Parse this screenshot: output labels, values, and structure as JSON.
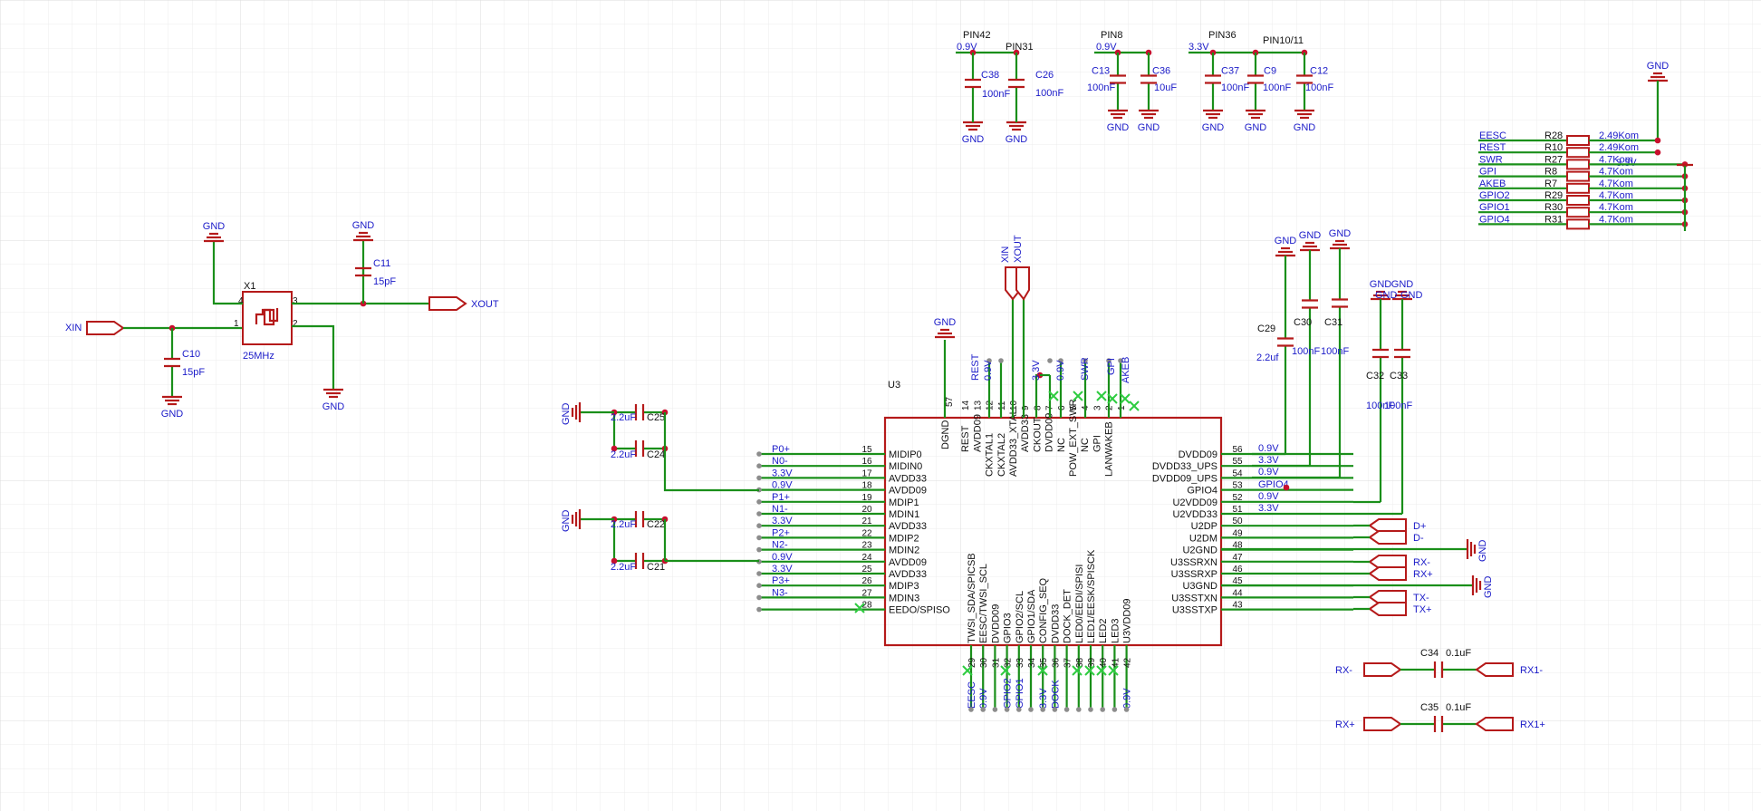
{
  "crystal": {
    "ref": "X1",
    "value": "25MHz",
    "in_net": "XIN",
    "out_net": "XOUT",
    "c_in": {
      "ref": "C10",
      "value": "15pF"
    },
    "c_out": {
      "ref": "C11",
      "value": "15pF"
    }
  },
  "gnd_label": "GND",
  "chip": {
    "ref": "U3"
  },
  "decoupling": {
    "pin42": "PIN42",
    "pin31": "PIN31",
    "pin8": "PIN8",
    "pin36": "PIN36",
    "pin10_11": "PIN10/11",
    "v09": "0.9V",
    "v33": "3.3V",
    "caps": [
      {
        "ref": "C38",
        "value": "100nF"
      },
      {
        "ref": "C26",
        "value": "100nF"
      },
      {
        "ref": "C13",
        "value": "100nF"
      },
      {
        "ref": "C36",
        "value": "10uF"
      },
      {
        "ref": "C37",
        "value": "100nF"
      },
      {
        "ref": "C9",
        "value": "100nF"
      },
      {
        "ref": "C12",
        "value": "100nF"
      }
    ]
  },
  "pullups": {
    "rail": "3.3V",
    "rows": [
      {
        "net": "EESC",
        "ref": "R28",
        "value": "2.49Kom"
      },
      {
        "net": "REST",
        "ref": "R10",
        "value": "2.49Kom"
      },
      {
        "net": "SWR",
        "ref": "R27",
        "value": "4.7Kom"
      },
      {
        "net": "GPI",
        "ref": "R8",
        "value": "4.7Kom"
      },
      {
        "net": "AKEB",
        "ref": "R7",
        "value": "4.7Kom"
      },
      {
        "net": "GPIO2",
        "ref": "R29",
        "value": "4.7Kom"
      },
      {
        "net": "GPIO1",
        "ref": "R30",
        "value": "4.7Kom"
      },
      {
        "net": "GPIO4",
        "ref": "R31",
        "value": "4.7Kom"
      }
    ]
  },
  "left_pins": [
    {
      "num": "15",
      "name": "MIDIP0",
      "net": "P0+"
    },
    {
      "num": "16",
      "name": "MIDIN0",
      "net": "N0-"
    },
    {
      "num": "17",
      "name": "AVDD33",
      "net": "3.3V"
    },
    {
      "num": "18",
      "name": "AVDD09",
      "net": "0.9V"
    },
    {
      "num": "19",
      "name": "MDIP1",
      "net": "P1+"
    },
    {
      "num": "20",
      "name": "MDIN1",
      "net": "N1-"
    },
    {
      "num": "21",
      "name": "AVDD33",
      "net": "3.3V"
    },
    {
      "num": "22",
      "name": "MDIP2",
      "net": "P2+"
    },
    {
      "num": "23",
      "name": "MDIN2",
      "net": "N2-"
    },
    {
      "num": "24",
      "name": "AVDD09",
      "net": "0.9V"
    },
    {
      "num": "25",
      "name": "AVDD33",
      "net": "3.3V"
    },
    {
      "num": "26",
      "name": "MDIP3",
      "net": "P3+"
    },
    {
      "num": "27",
      "name": "MDIN3",
      "net": "N3-"
    },
    {
      "num": "28",
      "name": "EEDO/SPISO",
      "net": ""
    }
  ],
  "right_pins": [
    {
      "num": "56",
      "name": "DVDD09",
      "net": "0.9V"
    },
    {
      "num": "55",
      "name": "DVDD33_UPS",
      "net": "3.3V"
    },
    {
      "num": "54",
      "name": "DVDD09_UPS",
      "net": "0.9V"
    },
    {
      "num": "53",
      "name": "GPIO4",
      "net": "GPIO4"
    },
    {
      "num": "52",
      "name": "U2VDD09",
      "net": "0.9V"
    },
    {
      "num": "51",
      "name": "U2VDD33",
      "net": "3.3V"
    },
    {
      "num": "50",
      "name": "U2DP",
      "net": "D+"
    },
    {
      "num": "49",
      "name": "U2DM",
      "net": "D-"
    },
    {
      "num": "48",
      "name": "U2GND",
      "net": "GND"
    },
    {
      "num": "47",
      "name": "U3SSRXN",
      "net": "RX-"
    },
    {
      "num": "46",
      "name": "U3SSRXP",
      "net": "RX+"
    },
    {
      "num": "45",
      "name": "U3GND",
      "net": "GND"
    },
    {
      "num": "44",
      "name": "U3SSTXN",
      "net": "TX-"
    },
    {
      "num": "43",
      "name": "U3SSTXP",
      "net": "TX+"
    }
  ],
  "top_pins": [
    {
      "num": "57",
      "name": "DGND",
      "net": "GND"
    },
    {
      "num": "14",
      "name": "REST",
      "net": "REST"
    },
    {
      "num": "13",
      "name": "AVDD09",
      "net": "0.9V"
    },
    {
      "num": "12",
      "name": "CKXTAL1",
      "net": "XIN"
    },
    {
      "num": "11",
      "name": "CKXTAL2",
      "net": "XOUT"
    },
    {
      "num": "10",
      "name": "AVDD33_XTAL",
      "net": "3.3V"
    },
    {
      "num": "9",
      "name": "AVDD33",
      "net": ""
    },
    {
      "num": "8",
      "name": "CKOUT",
      "net": "0.9V"
    },
    {
      "num": "7",
      "name": "DVDD09",
      "net": ""
    },
    {
      "num": "6",
      "name": "NC",
      "net": "SWR"
    },
    {
      "num": "5",
      "name": "POW_EXT_SWR",
      "net": ""
    },
    {
      "num": "4",
      "name": "NC",
      "net": ""
    },
    {
      "num": "3",
      "name": "GPI",
      "net": "GPI"
    },
    {
      "num": "2",
      "name": "LANWAKEB",
      "net": "AKEB"
    },
    {
      "num": "1",
      "name": "",
      "net": ""
    }
  ],
  "bottom_pins": [
    {
      "num": "29",
      "name": "TWSI_SDA/SPICSB",
      "net": "EESC"
    },
    {
      "num": "30",
      "name": "EESC/TWSI_SCL",
      "net": "0.9V"
    },
    {
      "num": "31",
      "name": "DVDD09",
      "net": ""
    },
    {
      "num": "32",
      "name": "GPIO3",
      "net": "GPIO2"
    },
    {
      "num": "33",
      "name": "GPIO2/SCL",
      "net": "GPIO1"
    },
    {
      "num": "34",
      "name": "GPIO1/SDA",
      "net": ""
    },
    {
      "num": "35",
      "name": "CONFIG_SEQ",
      "net": "3.3V"
    },
    {
      "num": "36",
      "name": "DVDD33",
      "net": "DOCK"
    },
    {
      "num": "37",
      "name": "DOCK_DET",
      "net": ""
    },
    {
      "num": "38",
      "name": "LED0/EEDI/SPISI",
      "net": ""
    },
    {
      "num": "39",
      "name": "LED1/EESK/SPISCK",
      "net": ""
    },
    {
      "num": "40",
      "name": "LED2",
      "net": ""
    },
    {
      "num": "41",
      "name": "LED3",
      "net": ""
    },
    {
      "num": "42",
      "name": "U3VDD09",
      "net": "0.9V"
    }
  ],
  "mdi_caps": [
    {
      "ref": "C25",
      "value": "2.2uF"
    },
    {
      "ref": "C24",
      "value": "2.2uF"
    },
    {
      "ref": "C22",
      "value": "2.2uF"
    },
    {
      "ref": "C21",
      "value": "2.2uF"
    }
  ],
  "right_caps": [
    {
      "ref": "C29",
      "value": "2.2uf"
    },
    {
      "ref": "C30",
      "value": "100nF"
    },
    {
      "ref": "C31",
      "value": "100nF"
    },
    {
      "ref": "C32",
      "value": "100nF"
    },
    {
      "ref": "C33",
      "value": "100nF"
    }
  ],
  "coupling": [
    {
      "ref": "C34",
      "value": "0.1uF",
      "left": "RX-",
      "right": "RX1-"
    },
    {
      "ref": "C35",
      "value": "0.1uF",
      "left": "RX+",
      "right": "RX1+"
    }
  ]
}
